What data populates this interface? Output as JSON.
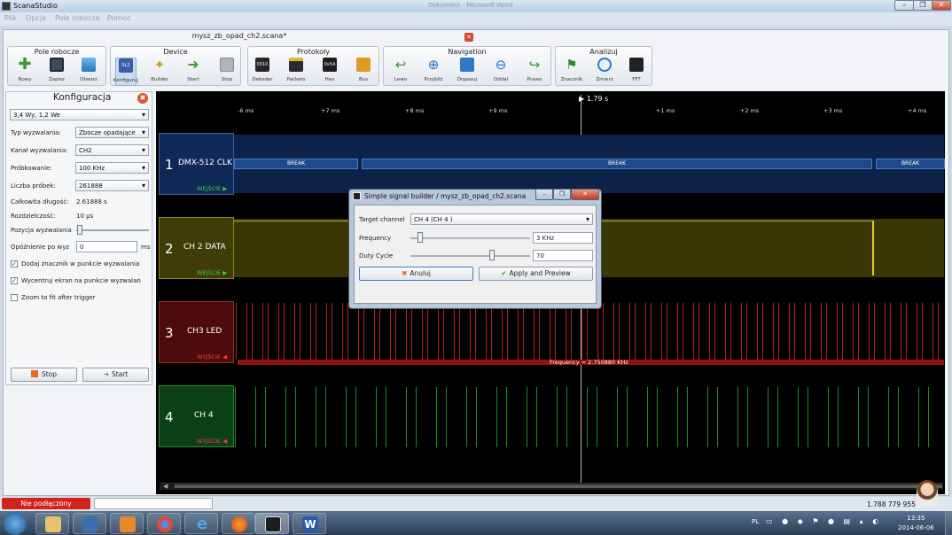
{
  "window": {
    "title": "ScanaStudio",
    "btn_min": "–",
    "btn_max": "❐",
    "btn_close": "✕",
    "bg_title": "Dokument - Microsoft Word"
  },
  "menu": [
    "Plik",
    "Opcje",
    "Pole robocze",
    "Pomoc"
  ],
  "doc_tab": {
    "title": "mysz_zb_opad_ch2.scana*",
    "close": "✕"
  },
  "toolbar": {
    "groups": [
      {
        "title": "Pole robocze",
        "buttons": [
          {
            "label": "Nowy",
            "icon": "plus-icon"
          },
          {
            "label": "Zapisz",
            "icon": "save-icon"
          },
          {
            "label": "Otwórz",
            "icon": "folder-icon"
          }
        ]
      },
      {
        "title": "Device",
        "buttons": [
          {
            "label": "Konfiguruj",
            "icon": "device-icon",
            "badge": "SL2"
          },
          {
            "label": "Builder",
            "icon": "wand-icon"
          },
          {
            "label": "Start",
            "icon": "arrow-right-icon"
          },
          {
            "label": "Stop",
            "icon": "stop-icon"
          }
        ]
      },
      {
        "title": "Protokoły",
        "buttons": [
          {
            "label": "Dekoder",
            "icon": "decoder-icon",
            "badge": "0010"
          },
          {
            "label": "Packets",
            "icon": "packets-icon"
          },
          {
            "label": "Hex",
            "icon": "hex-icon",
            "badge": "0x5A"
          },
          {
            "label": "Bus",
            "icon": "bus-icon"
          }
        ]
      },
      {
        "title": "Navigation",
        "buttons": [
          {
            "label": "Lewo",
            "icon": "arrow-left-icon"
          },
          {
            "label": "Przybliż",
            "icon": "zoom-in-icon"
          },
          {
            "label": "Dopasuj",
            "icon": "fit-icon"
          },
          {
            "label": "Oddal",
            "icon": "zoom-out-icon"
          },
          {
            "label": "Prawo",
            "icon": "arrow-right-icon"
          }
        ]
      },
      {
        "title": "Analizuj",
        "buttons": [
          {
            "label": "Znacznik",
            "icon": "flag-icon"
          },
          {
            "label": "Zmierz",
            "icon": "measure-icon"
          },
          {
            "label": "FFT",
            "icon": "fft-icon"
          }
        ]
      }
    ]
  },
  "config": {
    "title": "Konfiguracja",
    "preset": "3,4 Wy, 1,2 We",
    "trigger_type_label": "Typ wyzwalania:",
    "trigger_type": "Zbocze opadające",
    "trigger_channel_label": "Kanał wyzwalania:",
    "trigger_channel": "CH2",
    "sampling_label": "Próbkowanie:",
    "sampling": "100 KHz",
    "samples_label": "Liczba próbek:",
    "samples": "261888",
    "total_len_label": "Całkowita długość:",
    "total_len": "2.61888 s",
    "resolution_label": "Rozdzielczość:",
    "resolution": "10 µs",
    "trigger_pos_label": "Pozycja wyzwalania",
    "delay_label": "Opóźnienie po wyz",
    "delay": "0",
    "delay_unit": "ms",
    "checks": [
      {
        "label": "Dodaj znacznik w punkcie wyzwalania",
        "checked": true
      },
      {
        "label": "Wycentruj ekran na punkcie wyzwalan",
        "checked": true
      },
      {
        "label": "Zoom to fit after trigger",
        "checked": false
      }
    ],
    "stop_label": "Stop",
    "start_label": "Start"
  },
  "timeline": {
    "cursor": "1.79 s",
    "ticks": [
      "-6 ms",
      "+7 ms",
      "+8 ms",
      "+9 ms",
      "+1 ms",
      "+2 ms",
      "+3 ms",
      "+4 ms"
    ]
  },
  "channels": [
    {
      "num": "1",
      "name": "DMX-512 CLK",
      "dir": "WEJŚCIE ▶",
      "color": "#1a3a6e",
      "dircolor": "#3fd13f",
      "labels": [
        "BREAK",
        "BREAK",
        "BREAK"
      ]
    },
    {
      "num": "2",
      "name": "CH 2 DATA",
      "dir": "WEJŚCIE ▶",
      "color": "#4d4a0e",
      "dircolor": "#3fd13f"
    },
    {
      "num": "3",
      "name": "CH3 LED",
      "dir": "WYJŚCIE ◀",
      "color": "#5a0e0e",
      "dircolor": "#ff3b3b",
      "freq": "Frequency = 2.750880 KHz"
    },
    {
      "num": "4",
      "name": "CH 4",
      "dir": "WYJŚCIE ◀",
      "color": "#0f4a1c",
      "dircolor": "#ff3b3b"
    }
  ],
  "dialog": {
    "title": "Simple signal builder / mysz_zb_opad_ch2.scana",
    "target_label": "Target channel",
    "target": "CH 4 (CH 4 )",
    "freq_label": "Frequency",
    "freq": "3 KHz",
    "duty_label": "Duty Cycle",
    "duty": "70",
    "cancel": "Anuluj",
    "apply": "Apply and Preview"
  },
  "status": {
    "connection": "Nie podłączony",
    "time": "1.788 779 955 s"
  },
  "taskbar": {
    "lang": "PL",
    "time": "13:35",
    "date": "2014-06-06"
  }
}
